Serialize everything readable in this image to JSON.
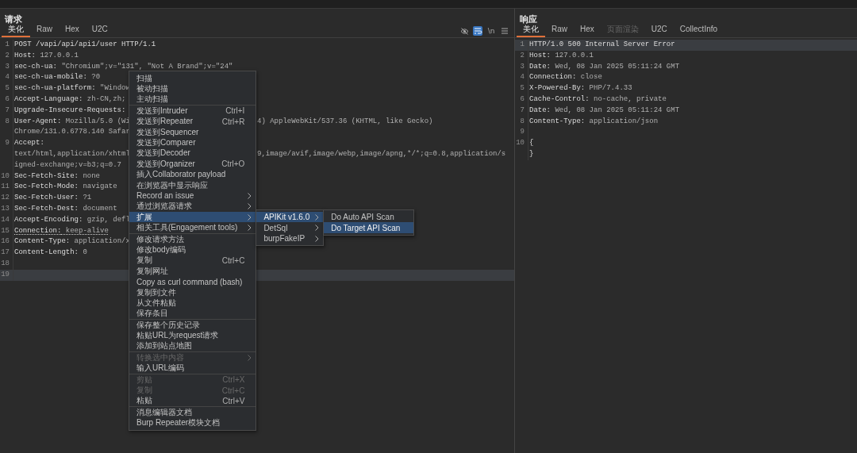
{
  "request": {
    "title": "请求",
    "tabs": [
      {
        "label": "美化",
        "selected": true,
        "disabled": false
      },
      {
        "label": "Raw",
        "selected": false,
        "disabled": false
      },
      {
        "label": "Hex",
        "selected": false,
        "disabled": false
      },
      {
        "label": "U2C",
        "selected": false,
        "disabled": false
      }
    ],
    "toolbar": [
      {
        "kind": "hide",
        "selected": false
      },
      {
        "kind": "wrap",
        "selected": true
      },
      {
        "kind": "text",
        "label": "\\n",
        "selected": false
      },
      {
        "kind": "menu",
        "selected": false
      }
    ],
    "lines": [
      {
        "number": "1",
        "key": "POST /vapi/api/api1/user HTTP/1.1",
        "current": false
      },
      {
        "number": "2",
        "key": "Host:",
        "value": " 127.0.0.1",
        "current": false
      },
      {
        "number": "3",
        "key": "sec-ch-ua:",
        "value": " \"Chromium\";v=\"131\", \"Not A Brand\";v=\"24\"",
        "current": false
      },
      {
        "number": "4",
        "key": "sec-ch-ua-mobile:",
        "value": " ?0",
        "current": false
      },
      {
        "number": "5",
        "key": "sec-ch-ua-platform:",
        "value": " \"Window",
        "current": false
      },
      {
        "number": "6",
        "key": "Accept-Language:",
        "value": " zh-CN,zh;",
        "current": false
      },
      {
        "number": "7",
        "key": "Upgrade-Insecure-Requests:",
        "current": false
      },
      {
        "number": "8",
        "key": "User-Agent:",
        "value": " Mozilla/5.0 (Wi",
        "right": "4) AppleWebKit/537.36 (KHTML, like Gecko)",
        "current": false
      },
      {
        "value": "Chrome/131.0.6778.140 Safar",
        "current": false
      },
      {
        "number": "9",
        "key": "Accept:",
        "current": false
      },
      {
        "value": "text/html,application/xhtml",
        "right": "9,image/avif,image/webp,image/apng,*/*;q=0.8,application/s",
        "current": false
      },
      {
        "value": "igned-exchange;v=b3;q=0.7",
        "current": false
      },
      {
        "number": "10",
        "key": "Sec-Fetch-Site:",
        "value": " none",
        "current": false
      },
      {
        "number": "11",
        "key": "Sec-Fetch-Mode:",
        "value": " navigate",
        "current": false
      },
      {
        "number": "12",
        "key": "Sec-Fetch-User:",
        "value": " ?1",
        "current": false
      },
      {
        "number": "13",
        "key": "Sec-Fetch-Dest:",
        "value": " document",
        "current": false
      },
      {
        "number": "14",
        "key": "Accept-Encoding:",
        "value": " gzip, defl",
        "current": false
      },
      {
        "number": "15",
        "key": "Connection:",
        "value": " keep-alive",
        "current": false,
        "underlined": true
      },
      {
        "number": "16",
        "key": "Content-Type:",
        "value": " application/x",
        "current": false
      },
      {
        "number": "17",
        "key": "Content-Length:",
        "value": " 0",
        "current": false
      },
      {
        "number": "18",
        "current": false
      },
      {
        "number": "19",
        "current": true
      }
    ]
  },
  "context_menu": {
    "sections": [
      {
        "items": [
          {
            "label": "扫描",
            "arrow": false,
            "disabled": false,
            "selected": false
          },
          {
            "label": "被动扫描",
            "arrow": false,
            "disabled": false,
            "selected": false
          },
          {
            "label": "主动扫描",
            "arrow": false,
            "disabled": false,
            "selected": false
          }
        ]
      },
      {
        "items": [
          {
            "label": "发送到Intruder",
            "shortcut": "Ctrl+I",
            "arrow": false,
            "disabled": false,
            "selected": false
          },
          {
            "label": "发送到Repeater",
            "shortcut": "Ctrl+R",
            "arrow": false,
            "disabled": false,
            "selected": false
          },
          {
            "label": "发送到Sequencer",
            "arrow": false,
            "disabled": false,
            "selected": false
          },
          {
            "label": "发送到Comparer",
            "arrow": false,
            "disabled": false,
            "selected": false
          },
          {
            "label": "发送到Decoder",
            "arrow": false,
            "disabled": false,
            "selected": false
          },
          {
            "label": "发送到Organizer",
            "shortcut": "Ctrl+O",
            "arrow": false,
            "disabled": false,
            "selected": false
          },
          {
            "label": "插入Collaborator payload",
            "arrow": false,
            "disabled": false,
            "selected": false
          },
          {
            "label": "在浏览器中显示响应",
            "arrow": false,
            "disabled": false,
            "selected": false
          },
          {
            "label": "Record an issue",
            "arrow": true,
            "disabled": false,
            "selected": false
          },
          {
            "label": "通过浏览器请求",
            "arrow": true,
            "disabled": false,
            "selected": false
          },
          {
            "label": "扩展",
            "arrow": true,
            "disabled": false,
            "selected": true,
            "children": [
              {
                "label": "APIKit v1.6.0",
                "arrow": true,
                "disabled": false,
                "selected": true,
                "children": [
                  {
                    "label": "Do Auto API Scan",
                    "arrow": false,
                    "disabled": false,
                    "selected": false
                  },
                  {
                    "label": "Do Target API Scan",
                    "arrow": false,
                    "disabled": false,
                    "selected": true
                  }
                ]
              },
              {
                "label": "DetSql",
                "arrow": true,
                "disabled": false,
                "selected": false
              },
              {
                "label": "burpFakeIP",
                "arrow": true,
                "disabled": false,
                "selected": false
              }
            ]
          },
          {
            "label": "相关工具(Engagement tools)",
            "arrow": true,
            "disabled": false,
            "selected": false
          }
        ]
      },
      {
        "items": [
          {
            "label": "修改请求方法",
            "arrow": false,
            "disabled": false,
            "selected": false
          },
          {
            "label": "修改body编码",
            "arrow": false,
            "disabled": false,
            "selected": false
          },
          {
            "label": "复制",
            "shortcut": "Ctrl+C",
            "arrow": false,
            "disabled": false,
            "selected": false
          },
          {
            "label": "复制网址",
            "arrow": false,
            "disabled": false,
            "selected": false
          },
          {
            "label": "Copy as curl command (bash)",
            "arrow": false,
            "disabled": false,
            "selected": false
          },
          {
            "label": "复制到文件",
            "arrow": false,
            "disabled": false,
            "selected": false
          },
          {
            "label": "从文件粘贴",
            "arrow": false,
            "disabled": false,
            "selected": false
          },
          {
            "label": "保存条目",
            "arrow": false,
            "disabled": false,
            "selected": false
          }
        ]
      },
      {
        "items": [
          {
            "label": "保存整个历史记录",
            "arrow": false,
            "disabled": false,
            "selected": false
          },
          {
            "label": "粘贴URL为request请求",
            "arrow": false,
            "disabled": false,
            "selected": false
          },
          {
            "label": "添加到站点地图",
            "arrow": false,
            "disabled": false,
            "selected": false
          }
        ]
      },
      {
        "items": [
          {
            "label": "转换选中内容",
            "arrow": true,
            "disabled": true,
            "selected": false
          },
          {
            "label": "输入URL编码",
            "arrow": false,
            "disabled": false,
            "selected": false
          }
        ]
      },
      {
        "items": [
          {
            "label": "剪贴",
            "shortcut": "Ctrl+X",
            "arrow": false,
            "disabled": true,
            "selected": false
          },
          {
            "label": "复制",
            "shortcut": "Ctrl+C",
            "arrow": false,
            "disabled": true,
            "selected": false
          },
          {
            "label": "粘贴",
            "shortcut": "Ctrl+V",
            "arrow": false,
            "disabled": false,
            "selected": false
          }
        ]
      },
      {
        "items": [
          {
            "label": "消息编辑器文档",
            "arrow": false,
            "disabled": false,
            "selected": false
          },
          {
            "label": "Burp Repeater模块文档",
            "arrow": false,
            "disabled": false,
            "selected": false
          }
        ]
      }
    ]
  },
  "response": {
    "title": "响应",
    "tabs": [
      {
        "label": "美化",
        "selected": true,
        "disabled": false
      },
      {
        "label": "Raw",
        "selected": false,
        "disabled": false
      },
      {
        "label": "Hex",
        "selected": false,
        "disabled": false
      },
      {
        "label": "页面渲染",
        "selected": false,
        "disabled": true
      },
      {
        "label": "U2C",
        "selected": false,
        "disabled": false
      },
      {
        "label": "CollectInfo",
        "selected": false,
        "disabled": false
      }
    ],
    "lines": [
      {
        "number": "1",
        "key": "HTTP/1.0 500 Internal Server Error",
        "current": true
      },
      {
        "number": "2",
        "key": "Host:",
        "value": " 127.0.0.1",
        "current": false
      },
      {
        "number": "3",
        "key": "Date:",
        "value": " Wed, 08 Jan 2025 05:11:24 GMT",
        "current": false
      },
      {
        "number": "4",
        "key": "Connection:",
        "value": " close",
        "current": false
      },
      {
        "number": "5",
        "key": "X-Powered-By:",
        "value": " PHP/7.4.33",
        "current": false
      },
      {
        "number": "6",
        "key": "Cache-Control:",
        "value": " no-cache, private",
        "current": false
      },
      {
        "number": "7",
        "key": "Date:",
        "value": " Wed, 08 Jan 2025 05:11:24 GMT",
        "current": false
      },
      {
        "number": "8",
        "key": "Content-Type:",
        "value": " application/json",
        "current": false
      },
      {
        "number": "9",
        "current": false
      },
      {
        "number": "10",
        "key": "{",
        "current": false
      },
      {
        "key": "}",
        "current": false
      }
    ]
  }
}
